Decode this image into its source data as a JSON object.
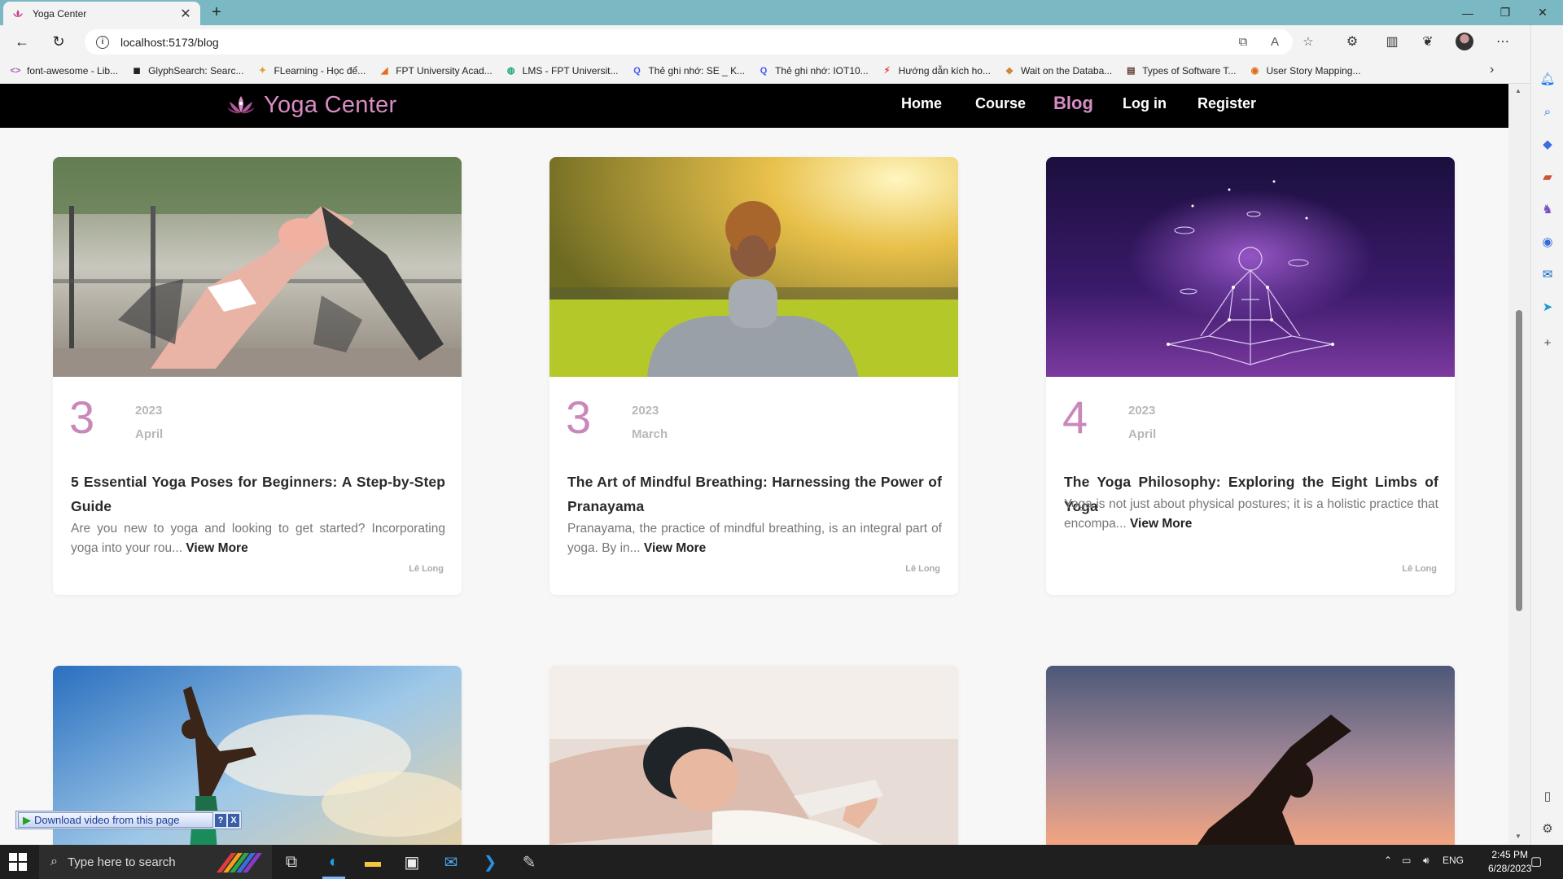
{
  "browser": {
    "tab_title": "Yoga Center",
    "url": "localhost:5173/blog",
    "bookmarks": [
      {
        "label": "font-awesome - Lib...",
        "icon": "code-icon",
        "color": "#a855b5"
      },
      {
        "label": "GlyphSearch: Searc...",
        "icon": "glyph-icon",
        "color": "#222222"
      },
      {
        "label": "FLearning - Học để...",
        "icon": "flearning-icon",
        "color": "#e0a020"
      },
      {
        "label": "FPT University Acad...",
        "icon": "fpt-icon",
        "color": "#e86a1a"
      },
      {
        "label": "LMS - FPT Universit...",
        "icon": "lms-icon",
        "color": "#1aa67a"
      },
      {
        "label": "Thẻ ghi nhớ: SE _ K...",
        "icon": "quizlet-icon",
        "color": "#4257f5"
      },
      {
        "label": "Thẻ ghi nhớ: IOT10...",
        "icon": "quizlet-icon",
        "color": "#4257f5"
      },
      {
        "label": "Hướng dẫn kích ho...",
        "icon": "bolt-icon",
        "color": "#e23c3c"
      },
      {
        "label": "Wait on the Databa...",
        "icon": "cat-icon",
        "color": "#c98a3a"
      },
      {
        "label": "Types of Software T...",
        "icon": "book-icon",
        "color": "#5a3a2a"
      },
      {
        "label": "User Story Mapping...",
        "icon": "ubuntu-icon",
        "color": "#e26a1a"
      }
    ]
  },
  "site": {
    "brand": "Yoga Center",
    "accent_color": "#d98cc4",
    "nav": [
      {
        "label": "Home",
        "active": false
      },
      {
        "label": "Course",
        "active": false
      },
      {
        "label": "Blog",
        "active": true
      },
      {
        "label": "Log in",
        "active": false
      },
      {
        "label": "Register",
        "active": false
      }
    ]
  },
  "posts": [
    {
      "day": "3",
      "year": "2023",
      "month": "April",
      "title": "5 Essential Yoga Poses for Beginners: A Step-by-Step Guide",
      "excerpt": "Are you new to yoga and looking to get started? Incorporating yoga into your rou...",
      "more": "View More",
      "author": "Lê Long",
      "image": "group-yoga-downward-dog-photo"
    },
    {
      "day": "3",
      "year": "2023",
      "month": "March",
      "title": "The Art of Mindful Breathing: Harnessing the Power of Pranayama",
      "excerpt": "Pranayama, the practice of mindful breathing, is an integral part of yoga. By in...",
      "more": "View More",
      "author": "Lê Long",
      "image": "woman-meditating-in-park-photo"
    },
    {
      "day": "4",
      "year": "2023",
      "month": "April",
      "title": "The Yoga Philosophy: Exploring the Eight Limbs of Yoga",
      "excerpt": "Yoga is not just about physical postures; it is a holistic practice that encompa...",
      "more": "View More",
      "author": "Lê Long",
      "image": "constellation-meditation-illustration"
    },
    {
      "image": "tree-pose-sky-photo"
    },
    {
      "image": "woman-sleeping-photo"
    },
    {
      "image": "sunset-yoga-silhouette-photo"
    }
  ],
  "overlay": {
    "download_label": "Download video from this page",
    "help": "?",
    "close": "X"
  },
  "taskbar": {
    "search_placeholder": "Type here to search",
    "language": "ENG",
    "time": "2:45 PM",
    "date": "6/28/2023"
  }
}
